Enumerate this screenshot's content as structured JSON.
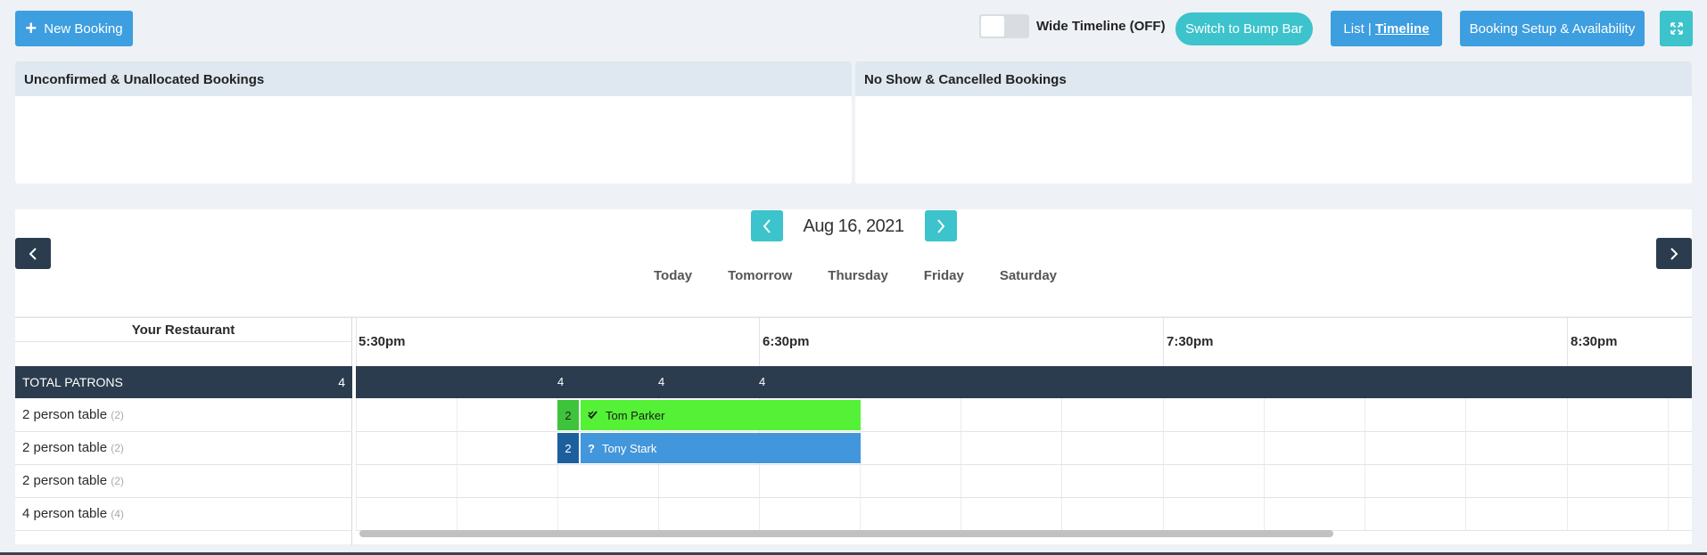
{
  "toolbar": {
    "new_booking": "New Booking",
    "wide_timeline": "Wide Timeline (OFF)",
    "bump_bar": "Switch to Bump Bar",
    "list_label": "List",
    "timeline_label": "Timeline",
    "setup": "Booking Setup & Availability"
  },
  "panels": {
    "left_title": "Unconfirmed & Unallocated Bookings",
    "right_title": "No Show & Cancelled Bookings"
  },
  "date": {
    "current": "Aug 16, 2021",
    "days": [
      "Today",
      "Tomorrow",
      "Thursday",
      "Friday",
      "Saturday"
    ]
  },
  "grid": {
    "restaurant": "Your Restaurant",
    "total_label": "TOTAL PATRONS",
    "total_count": "4",
    "times": [
      "5:30pm",
      "6:30pm",
      "7:30pm",
      "8:30pm"
    ],
    "slot_counts": [
      "4",
      "4",
      "4"
    ],
    "tables": [
      {
        "label": "2 person table",
        "cap": "(2)"
      },
      {
        "label": "2 person table",
        "cap": "(2)"
      },
      {
        "label": "2 person table",
        "cap": "(2)"
      },
      {
        "label": "4 person table",
        "cap": "(4)"
      }
    ],
    "bookings": [
      {
        "party": "2",
        "name": "Tom Parker",
        "status": "confirmed"
      },
      {
        "party": "2",
        "name": "Tony Stark",
        "status": "unconfirmed"
      }
    ]
  },
  "colors": {
    "primary": "#3d9ee0",
    "teal": "#3cc3cc",
    "dark": "#2b3c4e",
    "confirmed": "#55f137",
    "unconfirmed": "#4296db"
  }
}
